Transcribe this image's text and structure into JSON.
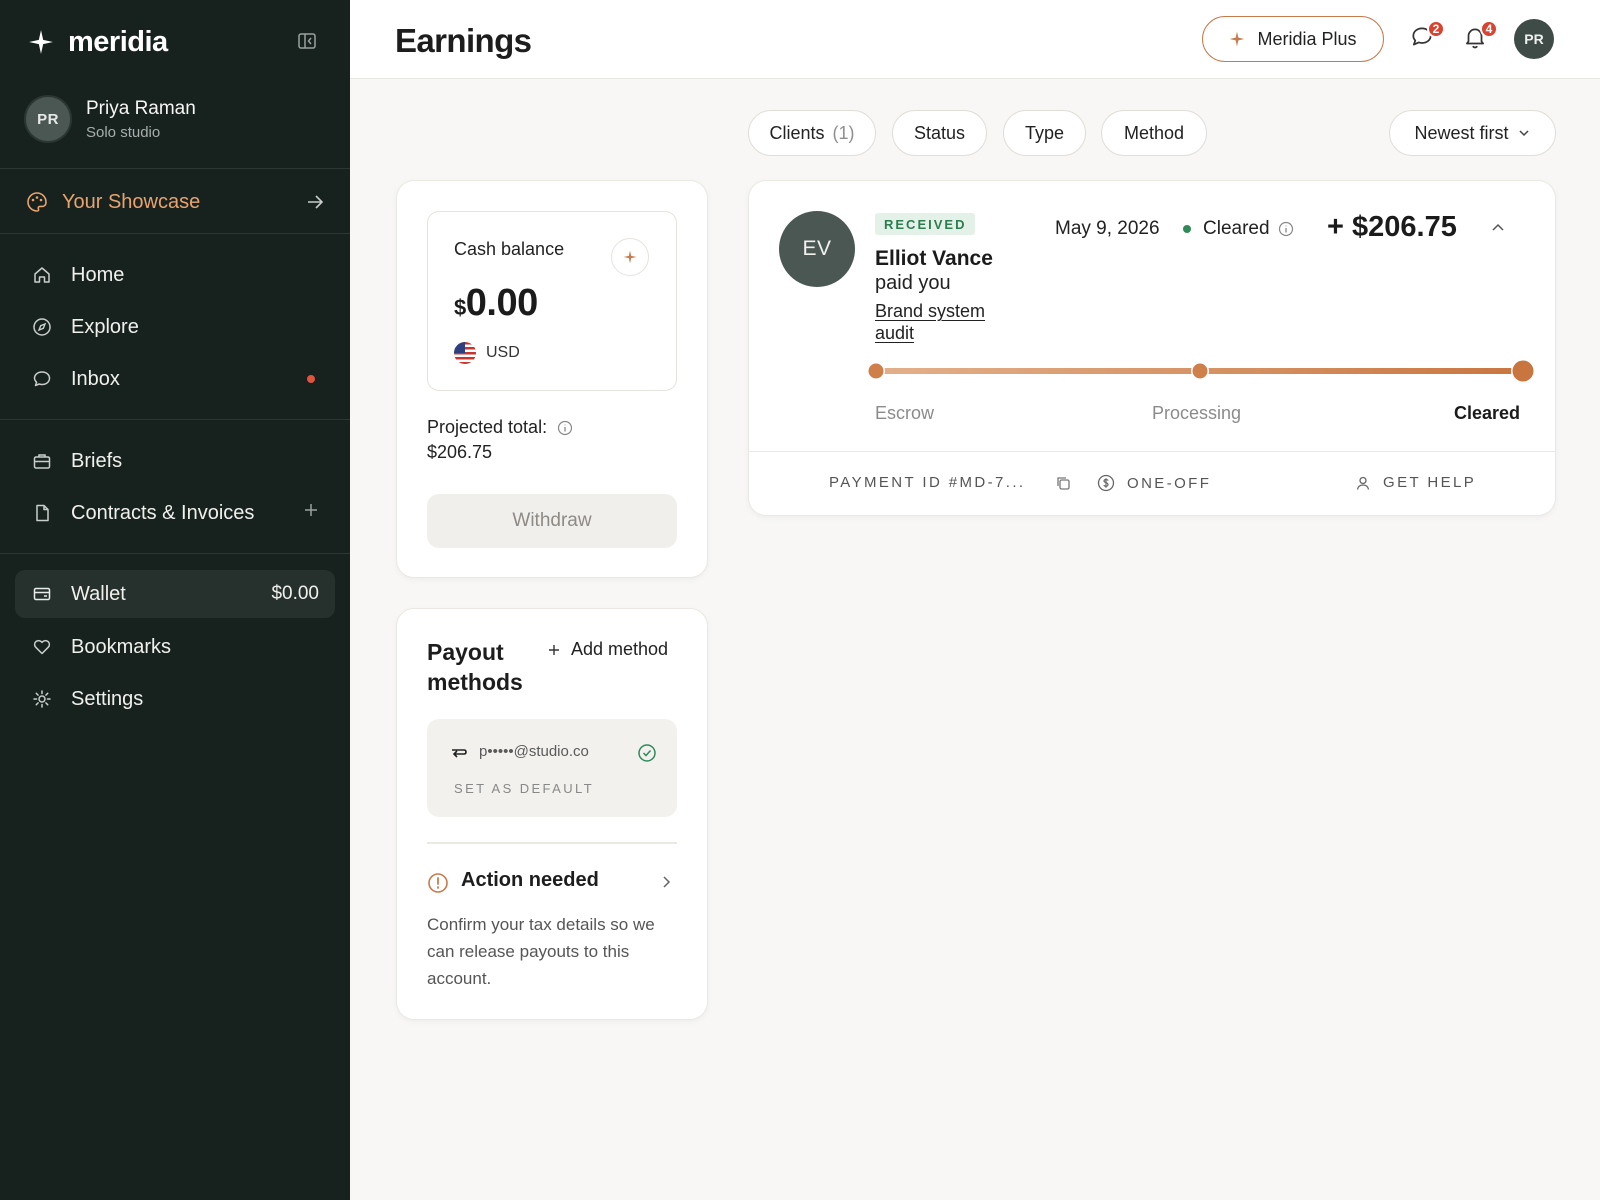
{
  "sidebar": {
    "brand": "meridia",
    "user": {
      "initials": "PR",
      "name": "Priya Raman",
      "subtitle": "Solo studio"
    },
    "showcase_label": "Your Showcase",
    "nav": [
      {
        "label": "Home",
        "icon": "home-icon"
      },
      {
        "label": "Explore",
        "icon": "compass-icon"
      },
      {
        "label": "Inbox",
        "icon": "chat-icon",
        "has_dot": true
      },
      {
        "label": "Briefs",
        "icon": "briefcase-icon"
      },
      {
        "label": "Contracts & Invoices",
        "icon": "document-icon"
      },
      {
        "label": "Wallet",
        "icon": "wallet-icon",
        "value": "$0.00",
        "active": true
      },
      {
        "label": "Bookmarks",
        "icon": "heart-icon"
      },
      {
        "label": "Settings",
        "icon": "gear-icon"
      }
    ]
  },
  "header": {
    "title": "Earnings",
    "plus_label": "Meridia Plus",
    "messages_count": "2",
    "notifications_count": "4",
    "avatar_initials": "PR"
  },
  "filters": {
    "clients_label": "Clients",
    "clients_count": "(1)",
    "status_label": "Status",
    "type_label": "Type",
    "method_label": "Method",
    "sort_label": "Newest first"
  },
  "balance": {
    "label": "Cash balance",
    "currency_symbol": "$",
    "amount": "0.00",
    "currency": "USD",
    "projected_label": "Projected total:",
    "projected_value": "$206.75",
    "withdraw_label": "Withdraw"
  },
  "payout": {
    "title": "Payout methods",
    "add_label": "Add method",
    "account": "p•••••@studio.co",
    "set_default_label": "SET AS DEFAULT",
    "action_title": "Action needed",
    "action_body": "Confirm your tax details so we can release payouts to this account."
  },
  "transaction": {
    "initials": "EV",
    "badge": "RECEIVED",
    "payer": "Elliot Vance",
    "paid_text": "paid you",
    "project": "Brand system audit",
    "date": "May 9, 2026",
    "status": "Cleared",
    "amount": "+ $206.75",
    "stages": [
      "Escrow",
      "Processing",
      "Cleared"
    ],
    "progress_stage_index": 2,
    "payment_id": "PAYMENT ID #MD-7...",
    "type": "ONE-OFF",
    "help_label": "GET HELP"
  },
  "colors": {
    "sidebar_bg": "#17221f",
    "accent": "#c67b4d",
    "showcase": "#e8a36e",
    "success": "#2f8a5a",
    "badge_red": "#d9432f"
  }
}
